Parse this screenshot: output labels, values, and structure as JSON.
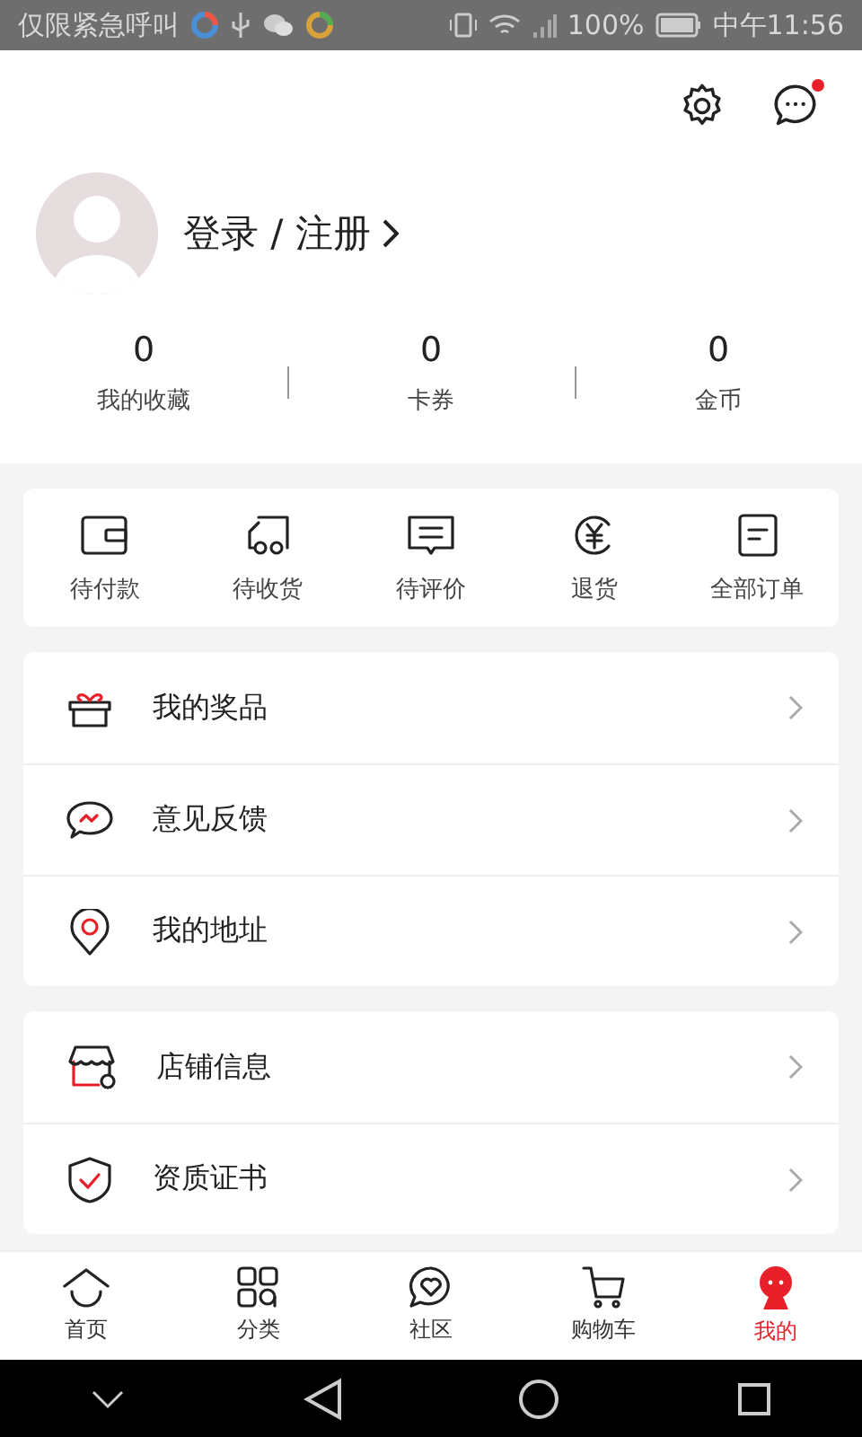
{
  "status_bar": {
    "carrier": "仅限紧急呼叫",
    "battery": "100%",
    "time": "中午11:56"
  },
  "header": {
    "message_unread": true
  },
  "profile": {
    "login": "登录 / 注册"
  },
  "stats": [
    {
      "value": "0",
      "label": "我的收藏"
    },
    {
      "value": "0",
      "label": "卡券"
    },
    {
      "value": "0",
      "label": "金币"
    }
  ],
  "orders": [
    {
      "kind": "wallet",
      "label": "待付款"
    },
    {
      "kind": "truck",
      "label": "待收货"
    },
    {
      "kind": "comment",
      "label": "待评价"
    },
    {
      "kind": "refund",
      "label": "退货"
    },
    {
      "kind": "list",
      "label": "全部订单"
    }
  ],
  "menu_groups": [
    [
      {
        "kind": "gift",
        "label": "我的奖品"
      },
      {
        "kind": "feedback",
        "label": "意见反馈"
      },
      {
        "kind": "pin",
        "label": "我的地址"
      }
    ],
    [
      {
        "kind": "shop",
        "label": "店铺信息"
      },
      {
        "kind": "shield",
        "label": "资质证书"
      }
    ]
  ],
  "tab_bar": [
    {
      "kind": "home",
      "label": "首页",
      "selected": false
    },
    {
      "kind": "grid",
      "label": "分类",
      "selected": false
    },
    {
      "kind": "community",
      "label": "社区",
      "selected": false
    },
    {
      "kind": "cart",
      "label": "购物车",
      "selected": false
    },
    {
      "kind": "me",
      "label": "我的",
      "selected": true
    }
  ]
}
